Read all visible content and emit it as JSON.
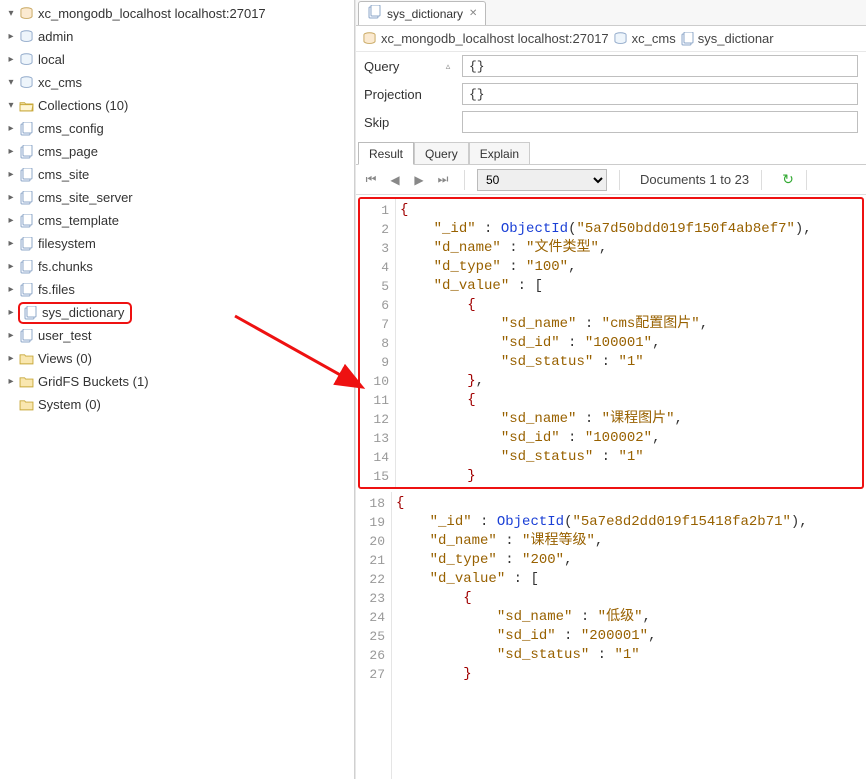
{
  "connection": {
    "label": "xc_mongodb_localhost localhost:27017"
  },
  "tree": {
    "admin": "admin",
    "local": "local",
    "xc_cms": "xc_cms",
    "collections": "Collections (10)",
    "items": [
      "cms_config",
      "cms_page",
      "cms_site",
      "cms_site_server",
      "cms_template",
      "filesystem",
      "fs.chunks",
      "fs.files",
      "sys_dictionary",
      "user_test"
    ],
    "views": "Views (0)",
    "gridfs": "GridFS Buckets (1)",
    "system": "System (0)"
  },
  "tab": {
    "title": "sys_dictionary"
  },
  "breadcrumb": {
    "a": "xc_mongodb_localhost localhost:27017",
    "b": "xc_cms",
    "c": "sys_dictionar"
  },
  "form": {
    "queryLabel": "Query",
    "queryValue": "{}",
    "projectionLabel": "Projection",
    "projectionValue": "{}",
    "skipLabel": "Skip",
    "skipValue": ""
  },
  "subtabs": {
    "result": "Result",
    "query": "Query",
    "explain": "Explain"
  },
  "toolbar": {
    "pageSize": "50",
    "docrange": "Documents 1 to 23"
  },
  "chart_data": {
    "type": "table",
    "collection": "sys_dictionary",
    "documents": [
      {
        "_id": "5a7d50bdd019f150f4ab8ef7",
        "d_name": "文件类型",
        "d_type": "100",
        "d_value": [
          {
            "sd_name": "cms配置图片",
            "sd_id": "100001",
            "sd_status": "1"
          },
          {
            "sd_name": "课程图片",
            "sd_id": "100002",
            "sd_status": "1"
          }
        ]
      },
      {
        "_id": "5a7e8d2dd019f15418fa2b71",
        "d_name": "课程等级",
        "d_type": "200",
        "d_value": [
          {
            "sd_name": "低级",
            "sd_id": "200001",
            "sd_status": "1"
          }
        ]
      }
    ]
  }
}
